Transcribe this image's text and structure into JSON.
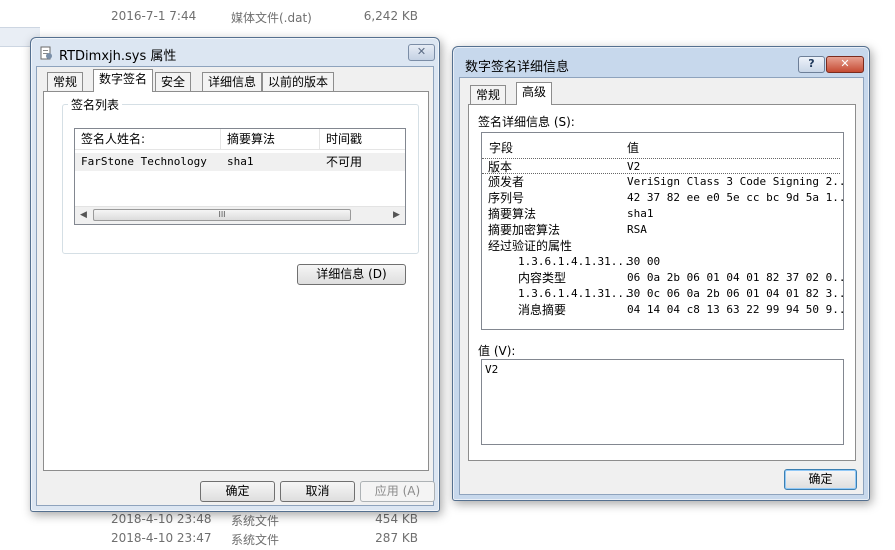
{
  "background": {
    "rows_top": [
      {
        "date": "2016-7-1 7:44",
        "type": "媒体文件(.dat)",
        "size": "6,242 KB"
      }
    ],
    "rows_bottom": [
      {
        "date": "2018-4-10 23:48",
        "type": "系统文件",
        "size": "454 KB"
      },
      {
        "date": "2018-4-10 23:47",
        "type": "系统文件",
        "size": "287 KB"
      }
    ]
  },
  "props": {
    "title": "RTDimxjh.sys 属性",
    "tabs": [
      {
        "label": "常规"
      },
      {
        "label": "数字签名"
      },
      {
        "label": "安全"
      },
      {
        "label": "详细信息"
      },
      {
        "label": "以前的版本"
      }
    ],
    "group_label": "签名列表",
    "columns": [
      "签名人姓名:",
      "摘要算法",
      "时间戳"
    ],
    "row": {
      "name": "FarStone Technology",
      "algo": "sha1",
      "timestamp": "不可用"
    },
    "scroll_thumb": "III",
    "details_button": "详细信息 (D)",
    "ok": "确定",
    "cancel": "取消",
    "apply": "应用 (A)"
  },
  "sig": {
    "title": "数字签名详细信息",
    "help": "?",
    "tabs": [
      {
        "label": "常规"
      },
      {
        "label": "高级"
      }
    ],
    "details_label": "签名详细信息 (S):",
    "columns": [
      "字段",
      "值"
    ],
    "rows": [
      {
        "field": "版本",
        "value": "V2"
      },
      {
        "field": "颁发者",
        "value": "VeriSign Class 3 Code Signing 2..."
      },
      {
        "field": "序列号",
        "value": "42 37 82 ee e0 5e cc bc 9d 5a 1..."
      },
      {
        "field": "摘要算法",
        "value": "sha1"
      },
      {
        "field": "摘要加密算法",
        "value": "RSA"
      },
      {
        "field": "经过验证的属性",
        "value": ""
      },
      {
        "field": "1.3.6.1.4.1.31...",
        "value": "30 00"
      },
      {
        "field": "内容类型",
        "value": "06 0a 2b 06 01 04 01 82 37 02 0..."
      },
      {
        "field": "1.3.6.1.4.1.31...",
        "value": "30 0c 06 0a 2b 06 01 04 01 82 3..."
      },
      {
        "field": "消息摘要",
        "value": "04 14 04 c8 13 63 22 99 94 50 9..."
      }
    ],
    "value_label": "值 (V):",
    "value_text": "V2",
    "ok": "确定"
  }
}
